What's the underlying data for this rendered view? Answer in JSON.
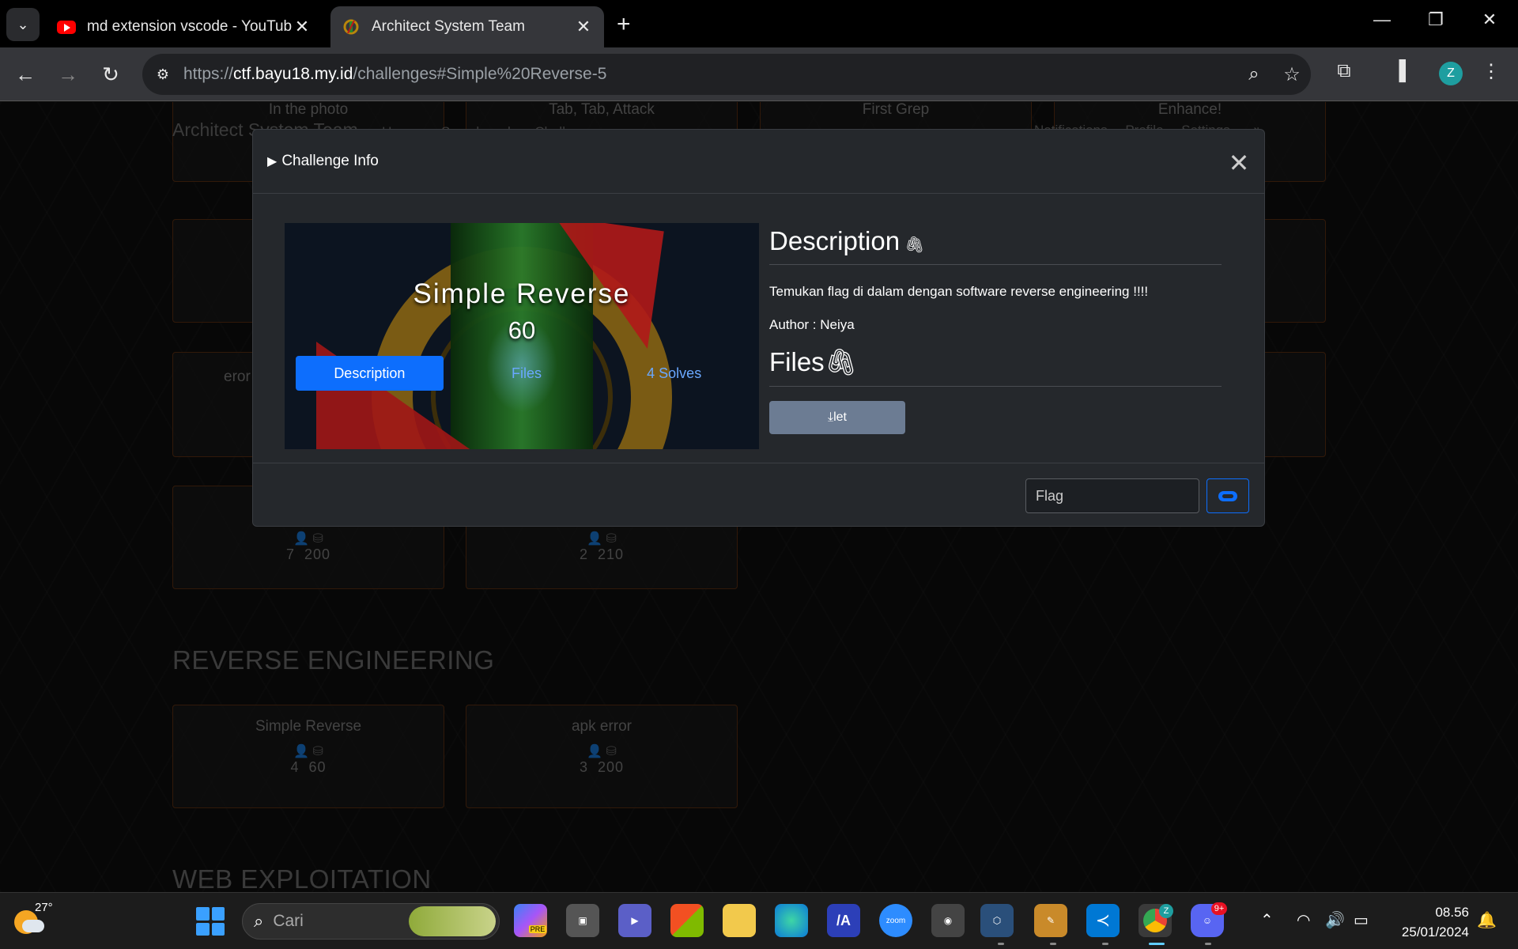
{
  "browser": {
    "tabs": [
      {
        "title": "md extension vscode - YouTube",
        "favicon": "youtube-icon",
        "active": false
      },
      {
        "title": "Architect System Team",
        "favicon": "ast-logo-icon",
        "active": true
      }
    ],
    "url_prefix": "https://",
    "url_host": "ctf.bayu18.my.id",
    "url_path": "/challenges#Simple%20Reverse-5",
    "profile_initial": "Z",
    "profile_color": "#1e9ea0"
  },
  "site": {
    "brand": "Architect System Team",
    "nav": [
      "Users",
      "Scoreboard",
      "Challenges"
    ],
    "nav_right": [
      "Notifications",
      "Profile",
      "Settings"
    ]
  },
  "background_cards": [
    {
      "name": "In the photo"
    },
    {
      "name": "Tab, Tab, Attack"
    },
    {
      "name": "First Grep"
    },
    {
      "name": "Enhance!"
    },
    {
      "name": "eror"
    },
    {
      "solves": "7",
      "points": "200"
    },
    {
      "solves": "2",
      "points": "210"
    }
  ],
  "sections": [
    {
      "title": "REVERSE ENGINEERING",
      "cards": [
        {
          "name": "Simple Reverse",
          "solves": "4",
          "points": "60"
        },
        {
          "name": "apk error",
          "solves": "3",
          "points": "200"
        }
      ]
    },
    {
      "title": "WEB EXPLOITATION"
    }
  ],
  "modal": {
    "header": "Challenge Info",
    "challenge_name": "Simple Reverse",
    "points": "60",
    "tabs": [
      "Description",
      "Files",
      "4 Solves"
    ],
    "description_heading": "Description",
    "description_text": "Temukan flag di dalam dengan software reverse engineering !!!!",
    "author_text": "Author : Neiya",
    "files_heading": "Files",
    "file_button": "let",
    "flag_placeholder": "Flag",
    "accent_color": "#0d6efd"
  },
  "taskbar": {
    "temperature": "27°",
    "search_placeholder": "Cari",
    "time": "08.56",
    "date": "25/01/2024",
    "discord_badge": "9+",
    "chrome_badge": "Z",
    "zoom_label": "zoom",
    "copilot_label": "PRE"
  }
}
